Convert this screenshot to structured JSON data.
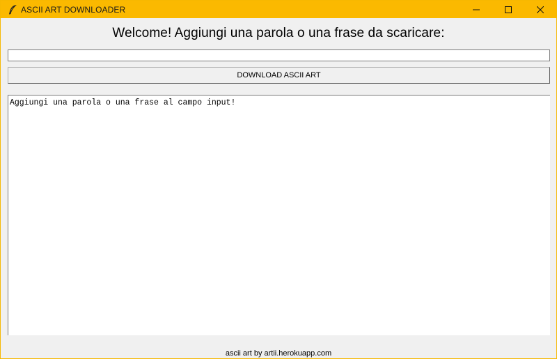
{
  "window": {
    "title": "ASCII ART DOWNLOADER",
    "icon": "feather-icon",
    "accent_color": "#fbb900"
  },
  "main": {
    "heading": "Welcome! Aggiungi una parola o una frase da scaricare:",
    "input_value": "",
    "download_label": "DOWNLOAD ASCII ART",
    "output_text": "Aggiungi una parola o una frase al campo input!"
  },
  "footer": {
    "credit": "ascii art by artii.herokuapp.com"
  }
}
